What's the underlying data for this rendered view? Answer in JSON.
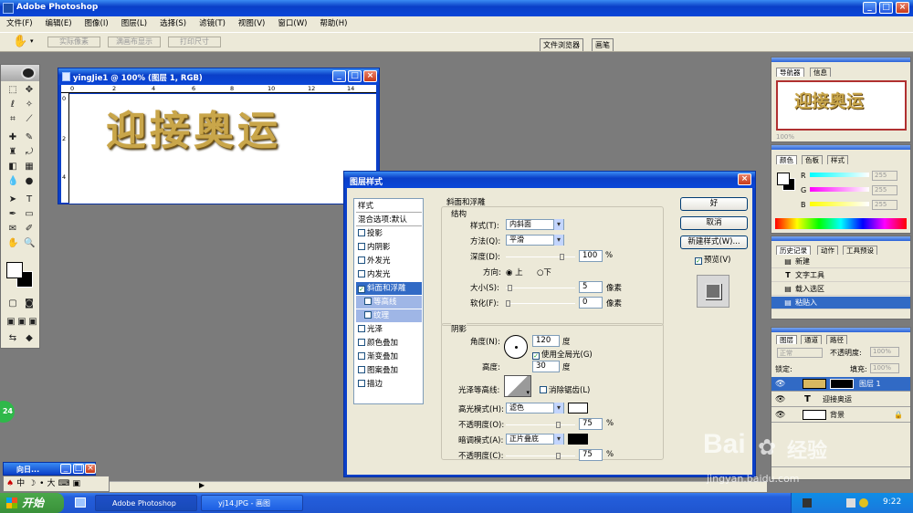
{
  "app": {
    "title": "Adobe Photoshop"
  },
  "menu": [
    "文件(F)",
    "编辑(E)",
    "图像(I)",
    "图层(L)",
    "选择(S)",
    "滤镜(T)",
    "视图(V)",
    "窗口(W)",
    "帮助(H)"
  ],
  "options": {
    "btn1": "实际像素",
    "btn2": "满画布显示",
    "btn3": "打印尺寸",
    "tab1": "文件浏览器",
    "tab2": "画笔"
  },
  "doc": {
    "title": "yingJie1 @ 100% (图层 1, RGB)",
    "artwork": "迎接奥运",
    "ruler": [
      "0",
      "2",
      "4",
      "6",
      "8",
      "10",
      "12",
      "14"
    ]
  },
  "dialog": {
    "title": "图层样式",
    "styles_header": "样式",
    "blend_options": "混合选项:默认",
    "styles": [
      {
        "label": "投影",
        "checked": false
      },
      {
        "label": "内阴影",
        "checked": false
      },
      {
        "label": "外发光",
        "checked": false
      },
      {
        "label": "内发光",
        "checked": false
      },
      {
        "label": "斜面和浮雕",
        "checked": true
      },
      {
        "label": "等高线",
        "checked": false,
        "sub": true
      },
      {
        "label": "纹理",
        "checked": false,
        "sub": true
      },
      {
        "label": "光泽",
        "checked": false
      },
      {
        "label": "颜色叠加",
        "checked": false
      },
      {
        "label": "渐变叠加",
        "checked": false
      },
      {
        "label": "图案叠加",
        "checked": false
      },
      {
        "label": "描边",
        "checked": false
      }
    ],
    "section_title": "斜面和浮雕",
    "structure": {
      "title": "结构",
      "style_label": "样式(T):",
      "style_value": "内斜面",
      "technique_label": "方法(Q):",
      "technique_value": "平滑",
      "depth_label": "深度(D):",
      "depth_value": "100",
      "depth_unit": "%",
      "depth_frac": 0.8,
      "direction_label": "方向:",
      "dir_up": "上",
      "dir_down": "下",
      "size_label": "大小(S):",
      "size_value": "5",
      "size_unit": "像素",
      "size_frac": 0.05,
      "soften_label": "软化(F):",
      "soften_value": "0",
      "soften_unit": "像素",
      "soften_frac": 0.0
    },
    "shading": {
      "title": "阴影",
      "angle_label": "角度(N):",
      "angle_value": "120",
      "angle_unit": "度",
      "global_light": "使用全局光(G)",
      "altitude_label": "高度:",
      "altitude_value": "30",
      "altitude_unit": "度",
      "gloss_label": "光泽等高线:",
      "antialias": "消除锯齿(L)",
      "highlight_label": "高光模式(H):",
      "highlight_value": "滤色",
      "highlight_color": "#ffffff",
      "hl_opacity_label": "不透明度(O):",
      "hl_opacity_value": "75",
      "hl_opacity_unit": "%",
      "hl_opacity_frac": 0.75,
      "shadow_label": "暗调模式(A):",
      "shadow_value": "正片叠底",
      "shadow_color": "#000000",
      "sh_opacity_label": "不透明度(C):",
      "sh_opacity_value": "75",
      "sh_opacity_unit": "%",
      "sh_opacity_frac": 0.75
    },
    "ok": "好",
    "cancel": "取消",
    "new_style": "新建样式(W)...",
    "preview": "预览(V)"
  },
  "navigator": {
    "tab1": "导航器",
    "tab2": "信息",
    "artwork": "迎接奥运",
    "zoom": "100%"
  },
  "color": {
    "tab1": "颜色",
    "tab2": "色板",
    "tab3": "样式",
    "r": "R",
    "g": "G",
    "b": "B",
    "r_val": "255",
    "g_val": "255",
    "b_val": "255"
  },
  "history": {
    "tab1": "历史记录",
    "tab2": "动作",
    "tab3": "工具预设",
    "items": [
      "新建",
      "文字工具",
      "载入选区",
      "粘贴入"
    ]
  },
  "layers": {
    "tab1": "图层",
    "tab2": "通道",
    "tab3": "路径",
    "mode": "正常",
    "opacity_label": "不透明度:",
    "opacity": "100%",
    "lock_label": "锁定:",
    "fill_label": "填充:",
    "fill": "100%",
    "rows": [
      {
        "name": "图层 1"
      },
      {
        "name": "迎接奥运"
      },
      {
        "name": "背景"
      }
    ]
  },
  "mini": {
    "title": "向日...",
    "ime": "中",
    "ime2": "大"
  },
  "badge": "24",
  "taskbar": {
    "start": "开始",
    "task1": "Adobe Photoshop",
    "task2": "yj14.JPG - 画图",
    "time": "9:22"
  },
  "watermark": {
    "logo": "Bai",
    "logo2": "经验",
    "url": "jingyan.baidu.com"
  }
}
